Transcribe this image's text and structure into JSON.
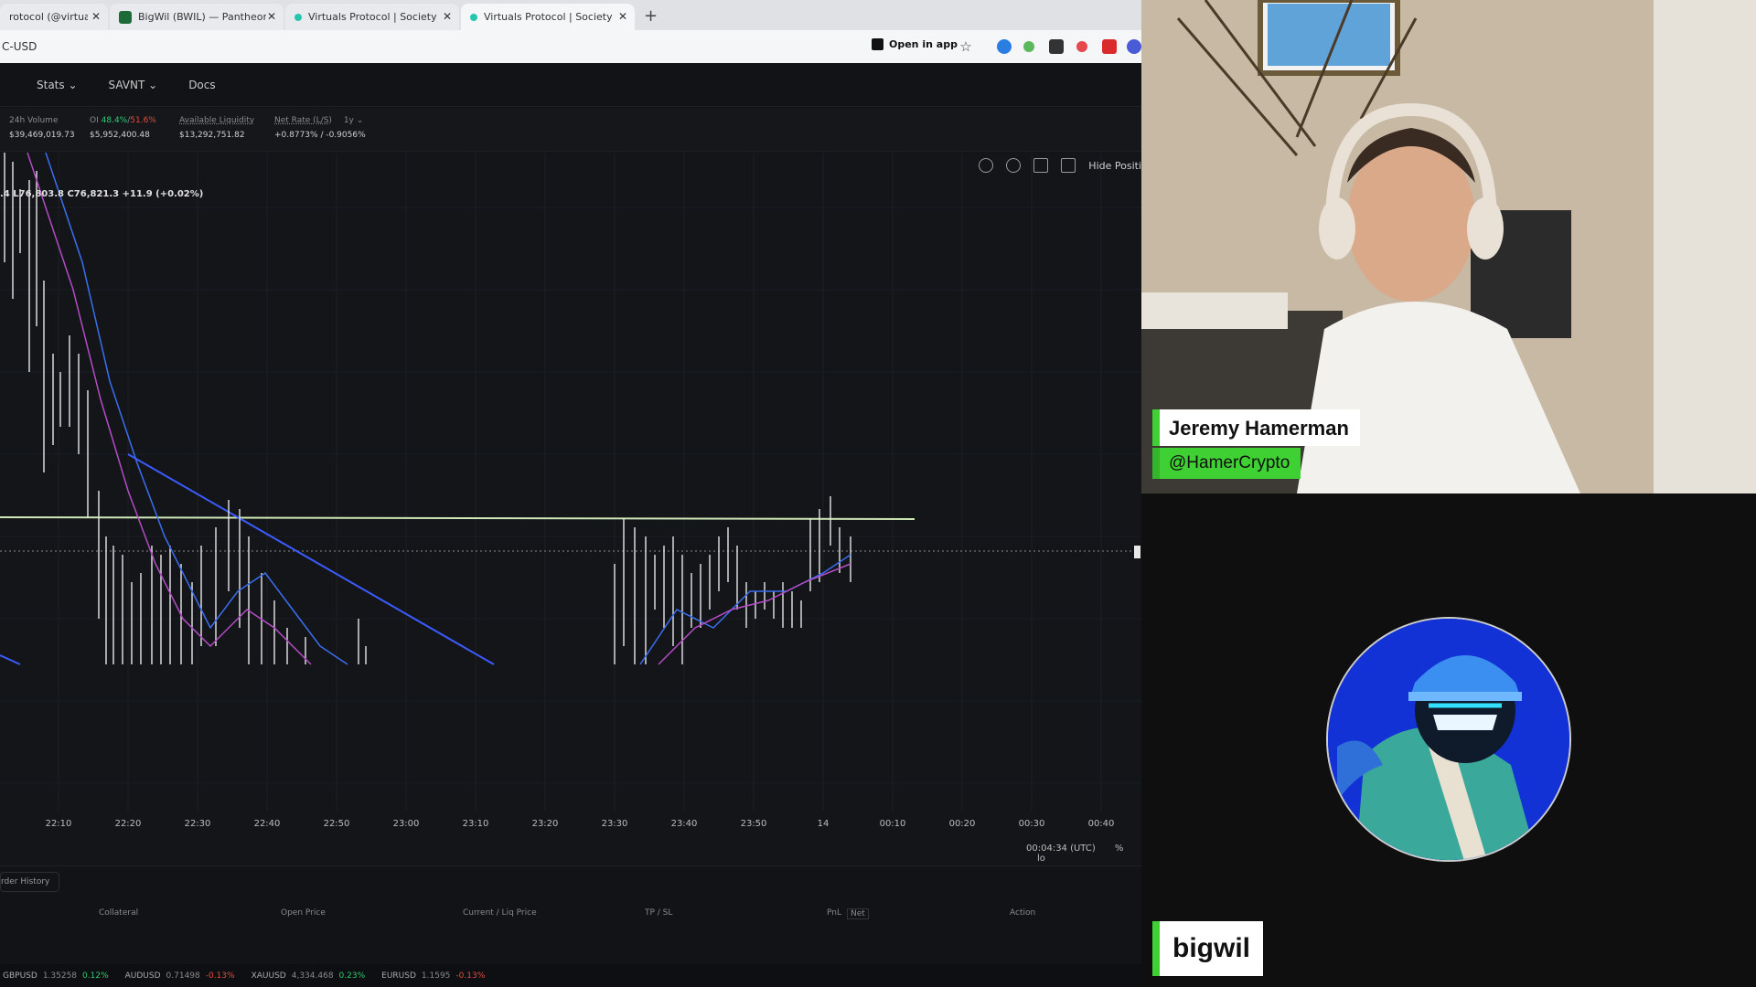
{
  "browser": {
    "tabs": [
      {
        "title": "rotocol (@virtuals_",
        "favicon_color": "#111111"
      },
      {
        "title": "BigWil (BWIL) — Pantheon",
        "favicon_color": "#1e6b3a"
      },
      {
        "title": "Virtuals Protocol | Society of AI",
        "favicon_color": "#23c7b0"
      },
      {
        "title": "Virtuals Protocol | Society of AI",
        "favicon_color": "#23c7b0"
      }
    ],
    "new_tab": "+",
    "close_glyph": "✕",
    "url": "C-USD",
    "open_in_app": "Open in app",
    "bookmark_icon": "☆"
  },
  "nav": {
    "items": [
      {
        "label": "Stats ⌄"
      },
      {
        "label": "SAVNT ⌄"
      },
      {
        "label": "Docs"
      }
    ]
  },
  "stats": {
    "volume": {
      "label": "24h Volume",
      "value": "$39,469,019.73"
    },
    "oi": {
      "label": "OI",
      "long": "48.4%",
      "sep": "/",
      "short": "51.6%",
      "value": "$5,952,400.48"
    },
    "liquidity": {
      "label": "Available Liquidity",
      "value": "$13,292,751.82"
    },
    "netrate": {
      "label": "Net Rate (L/S)",
      "period": "1y ⌄",
      "value": "+0.8773% / -0.9056%"
    }
  },
  "chart": {
    "ohlc_text": ".4  L76,803.8  C76,821.3  +11.9 (+0.02%)",
    "hide_positions": "Hide Positi",
    "utc_time": "00:04:34 (UTC)",
    "pct_toggle": "%",
    "log_toggle": "lo"
  },
  "chart_data": {
    "type": "candlestick",
    "x_ticks": [
      "22:10",
      "22:20",
      "22:30",
      "22:40",
      "22:50",
      "23:00",
      "23:10",
      "23:20",
      "23:30",
      "23:40",
      "23:50",
      "14",
      "00:10",
      "00:20",
      "00:30",
      "00:40"
    ],
    "title": "",
    "xlabel": "",
    "ylabel": "",
    "grid": true,
    "colors": {
      "candles": "#e8e8e8",
      "ma_fast": "#3b6ff0",
      "ma_slow": "#b44cc6",
      "trendline": "#3b5bff",
      "support_line": "#cfe9b7"
    }
  },
  "positions": {
    "order_history": "rder History",
    "columns": [
      "Collateral",
      "Open Price",
      "Current / Liq Price",
      "TP / SL",
      "PnL",
      "Net",
      "Action"
    ]
  },
  "ticker": [
    {
      "sym": "GBPUSD",
      "price": "1.35258",
      "chg": "0.12%",
      "dir": "up"
    },
    {
      "sym": "AUDUSD",
      "price": "0.71498",
      "chg": "-0.13%",
      "dir": "down"
    },
    {
      "sym": "XAUUSD",
      "price": "4,334.468",
      "chg": "0.23%",
      "dir": "up"
    },
    {
      "sym": "EURUSD",
      "price": "1.1595",
      "chg": "-0.13%",
      "dir": "down"
    }
  ],
  "stream": {
    "host_name": "Jeremy Hamerman",
    "host_handle": "@HamerCrypto",
    "guest_name": "bigwil",
    "accent_color": "#3fd134"
  }
}
